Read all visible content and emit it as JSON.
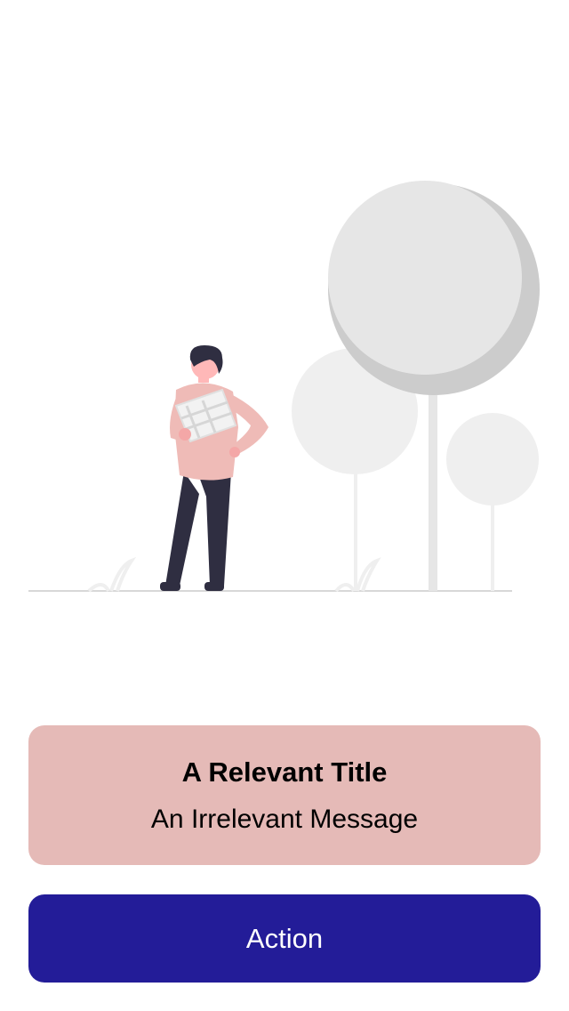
{
  "colors": {
    "card_bg": "#e5bab7",
    "button_bg": "#231c98",
    "figure_shirt": "#efbbb7",
    "figure_pants": "#2f2e41",
    "tree_light": "#efefef",
    "tree_mid": "#e6e6e6",
    "tree_dark": "#cccccc"
  },
  "illustration": {
    "icon": "person-holding-map-with-trees-illustration"
  },
  "card": {
    "title": "A Relevant Title",
    "message": "An Irrelevant Message"
  },
  "action_button": {
    "label": "Action"
  }
}
